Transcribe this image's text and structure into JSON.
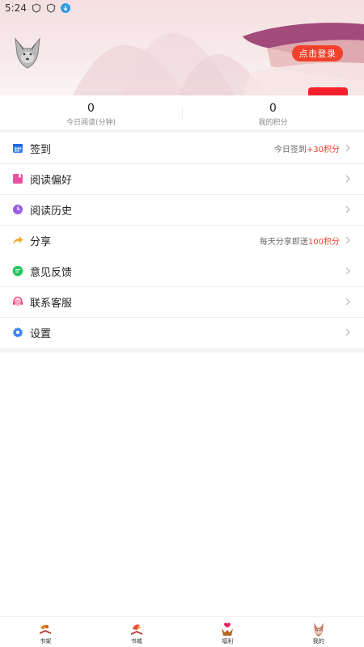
{
  "status_bar": {
    "time": "5:24"
  },
  "header": {
    "login_label": "点击登录"
  },
  "stats": [
    {
      "value": "0",
      "label": "今日阅读(分钟)"
    },
    {
      "value": "0",
      "label": "我的积分"
    }
  ],
  "menu_group_1": [
    {
      "label": "签到",
      "note_prefix": "今日签到",
      "note_accent": "+30积分",
      "icon": "calendar-icon"
    },
    {
      "label": "阅读偏好",
      "note_prefix": "",
      "note_accent": "",
      "icon": "bookmark-icon"
    },
    {
      "label": "阅读历史",
      "note_prefix": "",
      "note_accent": "",
      "icon": "clock-icon"
    },
    {
      "label": "分享",
      "note_prefix": "每天分享即送",
      "note_accent": "100积分",
      "icon": "share-icon"
    }
  ],
  "menu_group_2": [
    {
      "label": "意见反馈",
      "icon": "feedback-icon"
    },
    {
      "label": "联系客服",
      "icon": "customer-service-icon"
    },
    {
      "label": "设置",
      "icon": "settings-gear-icon"
    }
  ],
  "bottom_nav": [
    {
      "label": "书架",
      "icon": "bookshelf-icon"
    },
    {
      "label": "书城",
      "icon": "bookstore-icon"
    },
    {
      "label": "福利",
      "icon": "welfare-icon"
    },
    {
      "label": "我的",
      "icon": "profile-icon"
    }
  ],
  "colors": {
    "accent": "#f2412b",
    "red_tab": "#f5222d"
  }
}
